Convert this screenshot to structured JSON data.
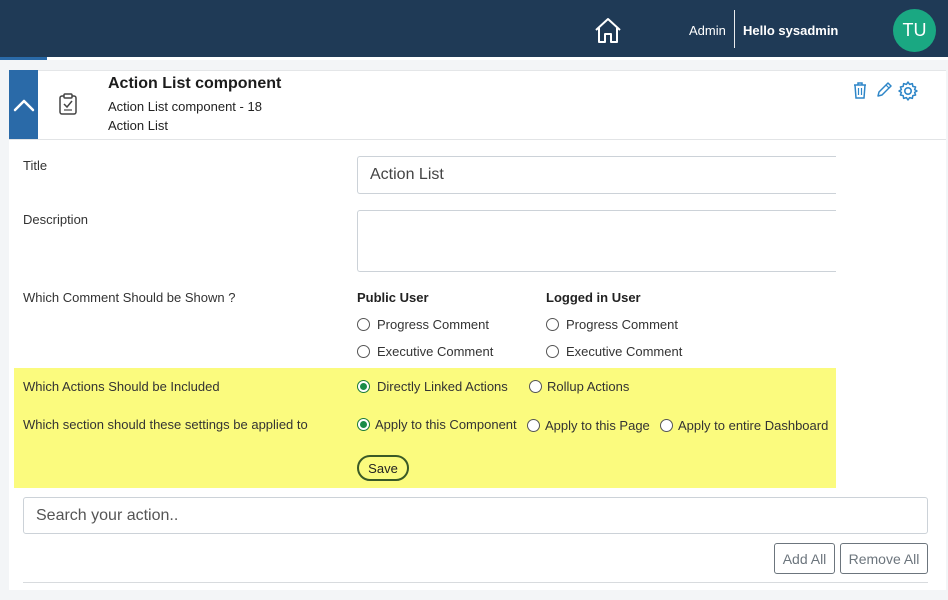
{
  "header": {
    "role": "Admin",
    "greeting": "Hello sysadmin",
    "avatar_initials": "TU",
    "icons": {
      "home": "home-icon"
    }
  },
  "component": {
    "title": "Action List component",
    "subtitle": "Action List component - 18",
    "type": "Action List",
    "icons": {
      "collapse": "chevron-up-icon",
      "type": "clipboard-check-icon",
      "delete": "trash-icon",
      "edit": "pencil-icon",
      "settings": "gear-icon"
    }
  },
  "form": {
    "title_label": "Title",
    "title_value": "Action List",
    "description_label": "Description",
    "description_value": "",
    "comment_question": "Which Comment Should be Shown ?",
    "public_user": {
      "heading": "Public User",
      "options": [
        "Progress Comment",
        "Executive Comment"
      ]
    },
    "logged_user": {
      "heading": "Logged in User",
      "options": [
        "Progress Comment",
        "Executive Comment"
      ]
    },
    "actions_question": "Which Actions Should be Included",
    "actions_options": [
      "Directly Linked Actions",
      "Rollup Actions"
    ],
    "actions_selected": "Directly Linked Actions",
    "section_question": "Which section should these settings be applied to",
    "section_options": [
      "Apply to this Component",
      "Apply to this Page",
      "Apply to entire Dashboard"
    ],
    "section_selected": "Apply to this Component",
    "save_label": "Save"
  },
  "actions": {
    "search_placeholder": "Search your action..",
    "add_all_label": "Add All",
    "remove_all_label": "Remove All"
  },
  "colors": {
    "topbar": "#1f3a56",
    "accent": "#2a6aa8",
    "avatar": "#1aa882",
    "highlight": "#fbfb7e",
    "icon_blue": "#2e86c8"
  }
}
